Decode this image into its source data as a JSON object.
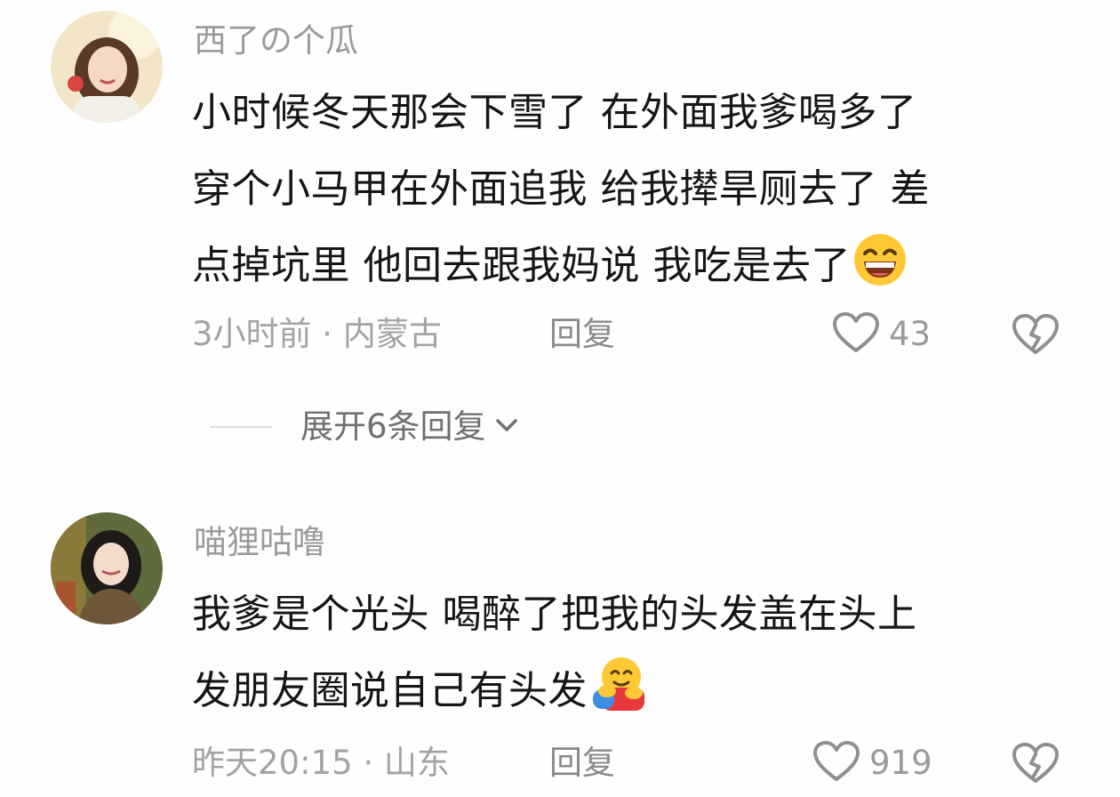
{
  "comments": [
    {
      "username": "西了の个瓜",
      "lines": [
        "小时候冬天那会下雪了 在外面我爹喝多了",
        "穿个小马甲在外面追我 给我撵旱厕去了 差",
        "点掉坑里 他回去跟我妈说 我吃是去了"
      ],
      "time_location": "3小时前 · 内蒙古",
      "reply_label": "回复",
      "likes": "43",
      "expand_label": "展开6条回复"
    },
    {
      "username": "喵狸咕噜",
      "lines": [
        "我爹是个光头 喝醉了把我的头发盖在头上",
        "发朋友圈说自己有头发"
      ],
      "time_location": "昨天20:15 · 山东",
      "reply_label": "回复",
      "likes": "919"
    }
  ]
}
